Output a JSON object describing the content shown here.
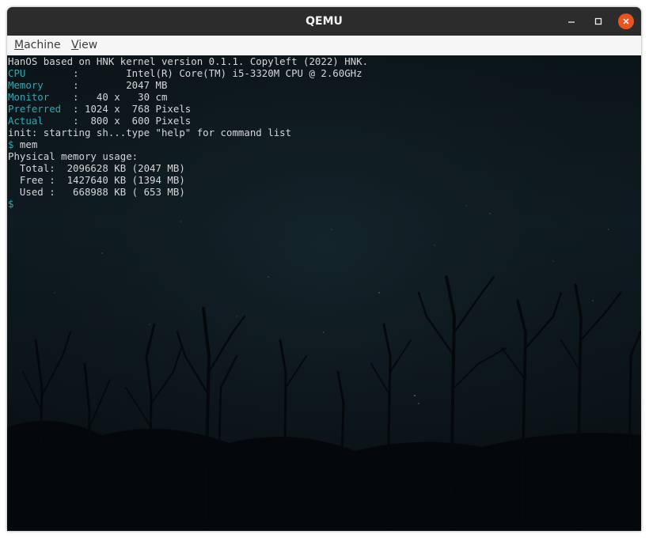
{
  "window": {
    "title": "QEMU"
  },
  "menubar": {
    "machine_first": "M",
    "machine_rest": "achine",
    "view_first": "V",
    "view_rest": "iew"
  },
  "terminal": {
    "lines": [
      {
        "key": "",
        "rest": "HanOS based on HNK kernel version 0.1.1. Copyleft (2022) HNK."
      },
      {
        "key": "CPU",
        "rest": "        :        Intel(R) Core(TM) i5-3320M CPU @ 2.60GHz"
      },
      {
        "key": "Memory",
        "rest": "     :        2047 MB"
      },
      {
        "key": "Monitor",
        "rest": "    :   40 x   30 cm"
      },
      {
        "key": "Preferred",
        "rest": "  : 1024 x  768 Pixels"
      },
      {
        "key": "Actual",
        "rest": "     :  800 x  600 Pixels"
      },
      {
        "key": "",
        "rest": "init: starting sh...type \"help\" for command list"
      },
      {
        "key": "$",
        "rest": " mem"
      },
      {
        "key": "",
        "rest": "Physical memory usage:"
      },
      {
        "key": "",
        "rest": "  Total:  2096628 KB (2047 MB)"
      },
      {
        "key": "",
        "rest": "  Free :  1427640 KB (1394 MB)"
      },
      {
        "key": "",
        "rest": "  Used :   668988 KB ( 653 MB)"
      },
      {
        "key": "$",
        "rest": ""
      }
    ]
  },
  "colors": {
    "label_cyan": "#2fa9b4",
    "text": "#d6d6d6",
    "close_button": "#e95420"
  },
  "icons": [
    "minimize-icon",
    "maximize-icon",
    "close-icon"
  ]
}
